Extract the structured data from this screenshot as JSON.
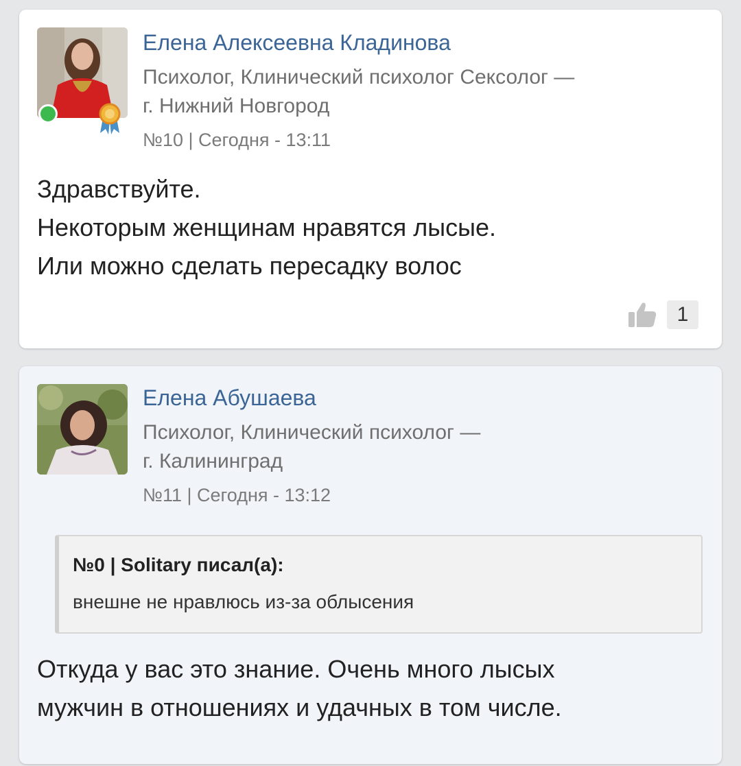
{
  "posts": [
    {
      "author": "Елена Алексеевна Кладинова",
      "role_line1": "Психолог, Клинический психолог Сексолог —",
      "role_line2": "г. Нижний Новгород",
      "meta": "№10 | Сегодня - 13:11",
      "online": true,
      "badge": "award-ribbon-icon",
      "text": [
        "Здравствуйте.",
        "Некоторым женщинам нравятся лысые.",
        "Или можно сделать пересадку волос"
      ],
      "likes": "1"
    },
    {
      "author": "Елена Абушаева",
      "role_line1": "Психолог, Клинический психолог —",
      "role_line2": "г. Калининград",
      "meta": "№11 | Сегодня - 13:12",
      "quote": {
        "header": "№0 | Solitary писал(а):",
        "body": "внешне не нравлюсь из-за облысения"
      },
      "text": [
        "Откуда у вас это знание. Очень много лысых",
        "мужчин в отношениях и удачных в том числе."
      ]
    }
  ],
  "colors": {
    "author": "#3a6596",
    "online": "#3dba4e",
    "page_bg": "#e6e7e9",
    "card2_bg": "#f1f4f8"
  }
}
